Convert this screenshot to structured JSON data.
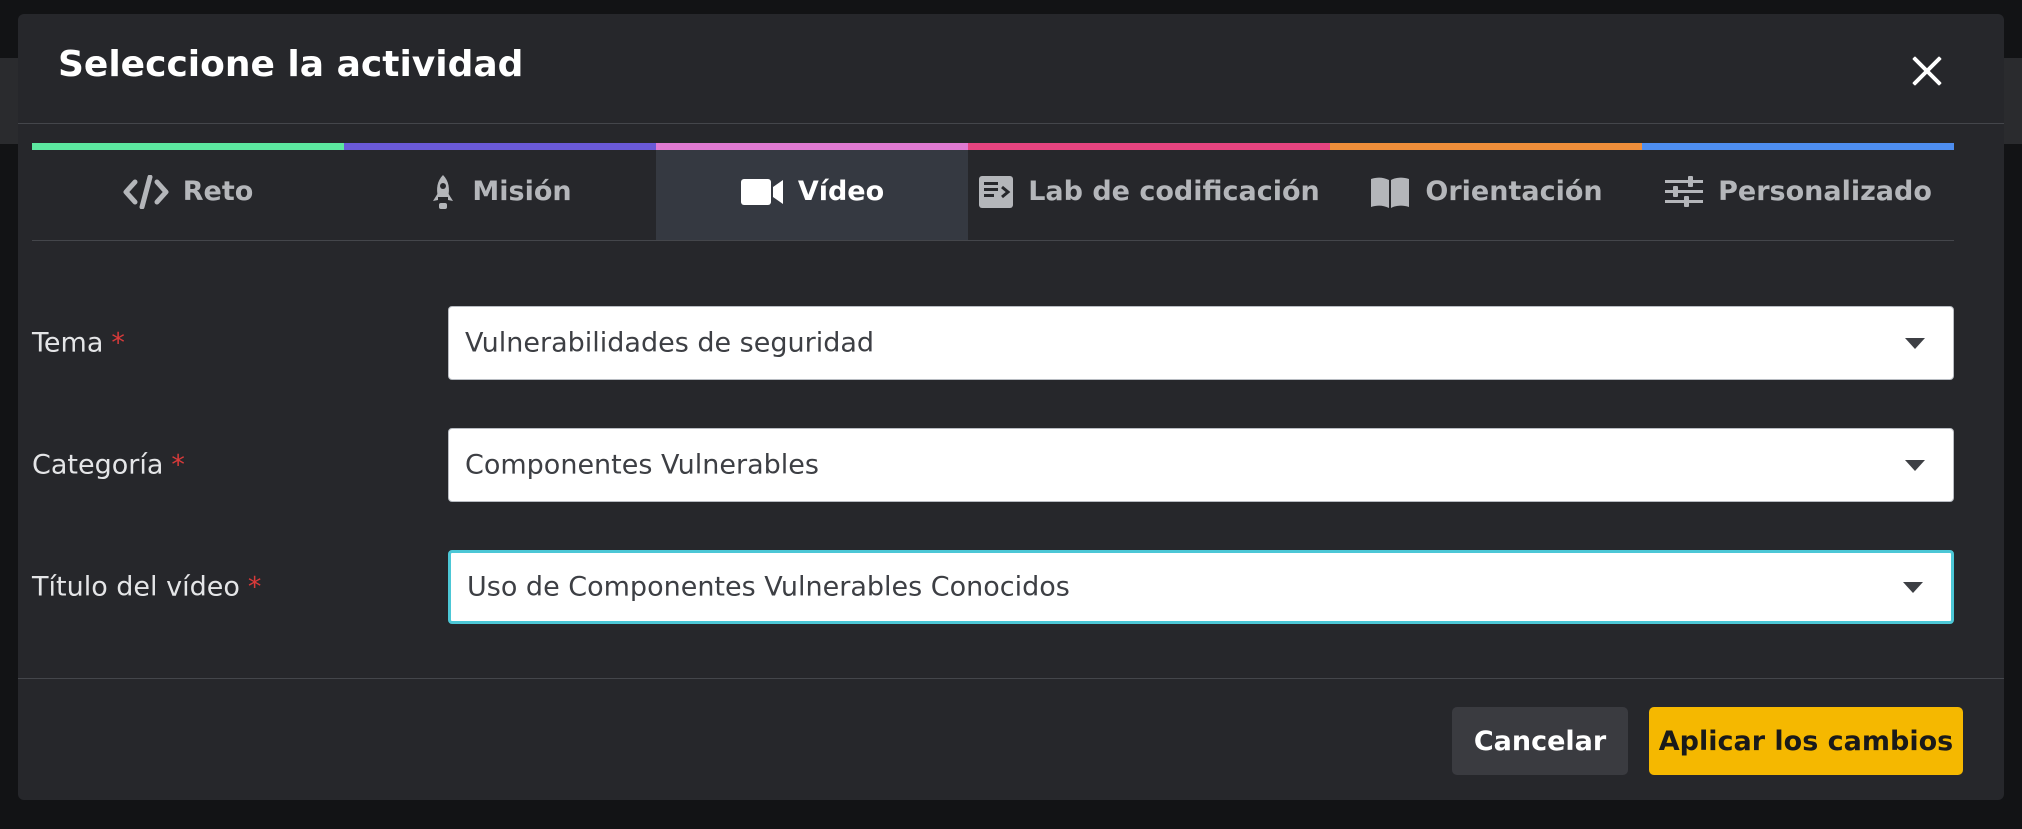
{
  "modal": {
    "title": "Seleccione la actividad"
  },
  "tabs": [
    {
      "label": "Reto",
      "icon": "code-icon",
      "color": "#5ce8a0",
      "active": false
    },
    {
      "label": "Misión",
      "icon": "rocket-icon",
      "color": "#6a5ad8",
      "active": false
    },
    {
      "label": "Vídeo",
      "icon": "video-camera-icon",
      "color": "#e07ad2",
      "active": true
    },
    {
      "label": "Lab de codificación",
      "icon": "code-lab-icon",
      "color": "#e64480",
      "active": false
    },
    {
      "label": "Orientación",
      "icon": "book-icon",
      "color": "#ef8e3a",
      "active": false
    },
    {
      "label": "Personalizado",
      "icon": "sliders-icon",
      "color": "#4e8ef0",
      "active": false
    }
  ],
  "form": {
    "tema": {
      "label": "Tema",
      "required_mark": "*",
      "value": "Vulnerabilidades de seguridad"
    },
    "categoria": {
      "label": "Categoría",
      "required_mark": "*",
      "value": "Componentes Vulnerables"
    },
    "titulo": {
      "label": "Título del vídeo",
      "required_mark": "*",
      "value": "Uso de Componentes Vulnerables Conocidos"
    }
  },
  "footer": {
    "cancel_label": "Cancelar",
    "apply_label": "Aplicar los cambios"
  },
  "colors": {
    "accent_focus": "#4cc7d6",
    "primary_button": "#f5b800",
    "required": "#d93a3a"
  }
}
